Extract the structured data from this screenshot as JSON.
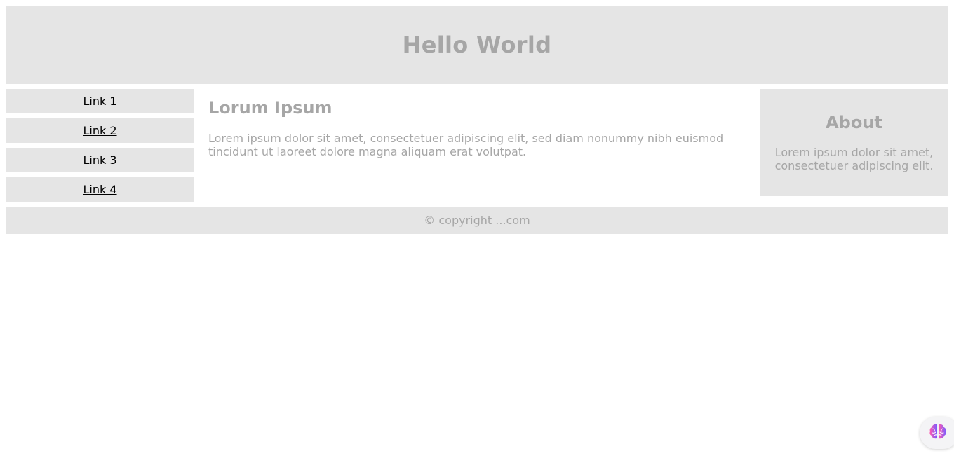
{
  "header": {
    "title": "Hello World"
  },
  "nav": {
    "links": [
      {
        "label": "Link 1"
      },
      {
        "label": "Link 2"
      },
      {
        "label": "Link 3"
      },
      {
        "label": "Link 4"
      }
    ]
  },
  "main": {
    "heading": "Lorum Ipsum",
    "body": "Lorem ipsum dolor sit amet, consectetuer adipiscing elit, sed diam nonummy nibh euismod tincidunt ut laoreet dolore magna aliquam erat volutpat."
  },
  "aside": {
    "heading": "About",
    "body": "Lorem ipsum dolor sit amet, consectetuer adipiscing elit."
  },
  "footer": {
    "text": "© copyright ...com"
  },
  "colors": {
    "panel_background": "#e5e5e5",
    "muted_text": "#a6a6a6",
    "link_text": "#000000",
    "brain_icon_gradient": [
      "#ff5ab0",
      "#7a5cff"
    ]
  },
  "icons": {
    "assistant": "brain-icon"
  }
}
